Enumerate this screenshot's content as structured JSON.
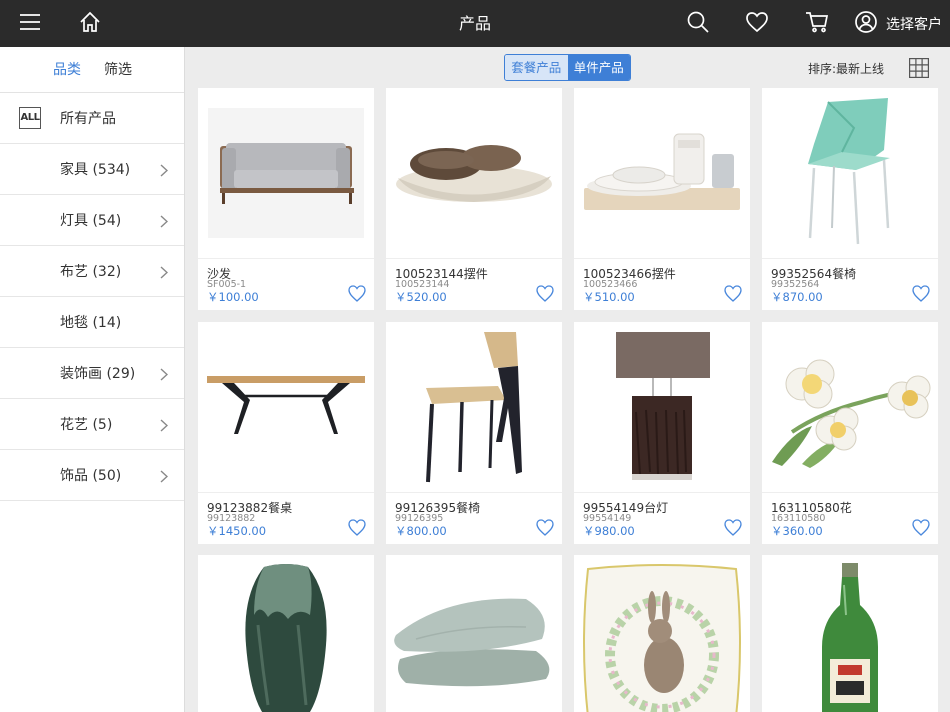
{
  "header": {
    "title": "产品",
    "customer_label": "选择客户",
    "icons": [
      "menu-icon",
      "home-icon",
      "search-icon",
      "heart-icon",
      "cart-icon",
      "user-icon"
    ]
  },
  "sidebar": {
    "tabs": [
      {
        "label": "品类",
        "active": true
      },
      {
        "label": "筛选",
        "active": false
      }
    ],
    "all_badge": "ALL",
    "categories": [
      {
        "label": "所有产品",
        "chevron": false
      },
      {
        "label": "家具 (534)",
        "chevron": true
      },
      {
        "label": "灯具 (54)",
        "chevron": true
      },
      {
        "label": "布艺 (32)",
        "chevron": true
      },
      {
        "label": "地毯 (14)",
        "chevron": false
      },
      {
        "label": "装饰画 (29)",
        "chevron": true
      },
      {
        "label": "花艺 (5)",
        "chevron": true
      },
      {
        "label": "饰品 (50)",
        "chevron": true
      }
    ]
  },
  "toolbar": {
    "segments": [
      {
        "label": "套餐产品",
        "active": false
      },
      {
        "label": "单件产品",
        "active": true
      }
    ],
    "sort_label": "排序:最新上线",
    "grid_icon": "grid-view-icon"
  },
  "products": [
    {
      "name": "沙发",
      "code": "SF005-1",
      "price": "￥100.00",
      "image": "sofa"
    },
    {
      "name": "100523144摆件",
      "code": "100523144",
      "price": "￥520.00",
      "image": "bread-plate"
    },
    {
      "name": "100523466摆件",
      "code": "100523466",
      "price": "￥510.00",
      "image": "tableware-set"
    },
    {
      "name": "99352564餐椅",
      "code": "99352564",
      "price": "￥870.00",
      "image": "mint-chair"
    },
    {
      "name": "99123882餐桌",
      "code": "99123882",
      "price": "￥1450.00",
      "image": "dining-table"
    },
    {
      "name": "99126395餐椅",
      "code": "99126395",
      "price": "￥800.00",
      "image": "wood-chair"
    },
    {
      "name": "99554149台灯",
      "code": "99554149",
      "price": "￥980.00",
      "image": "table-lamp"
    },
    {
      "name": "163110580花",
      "code": "163110580",
      "price": "￥360.00",
      "image": "daffodils"
    },
    {
      "image": "green-vase"
    },
    {
      "image": "grey-cushions"
    },
    {
      "image": "rabbit-pillow"
    },
    {
      "image": "green-bottle"
    }
  ],
  "colors": {
    "topbar": "#2b2b2b",
    "accent": "#3e7fd6",
    "background": "#ececec"
  }
}
